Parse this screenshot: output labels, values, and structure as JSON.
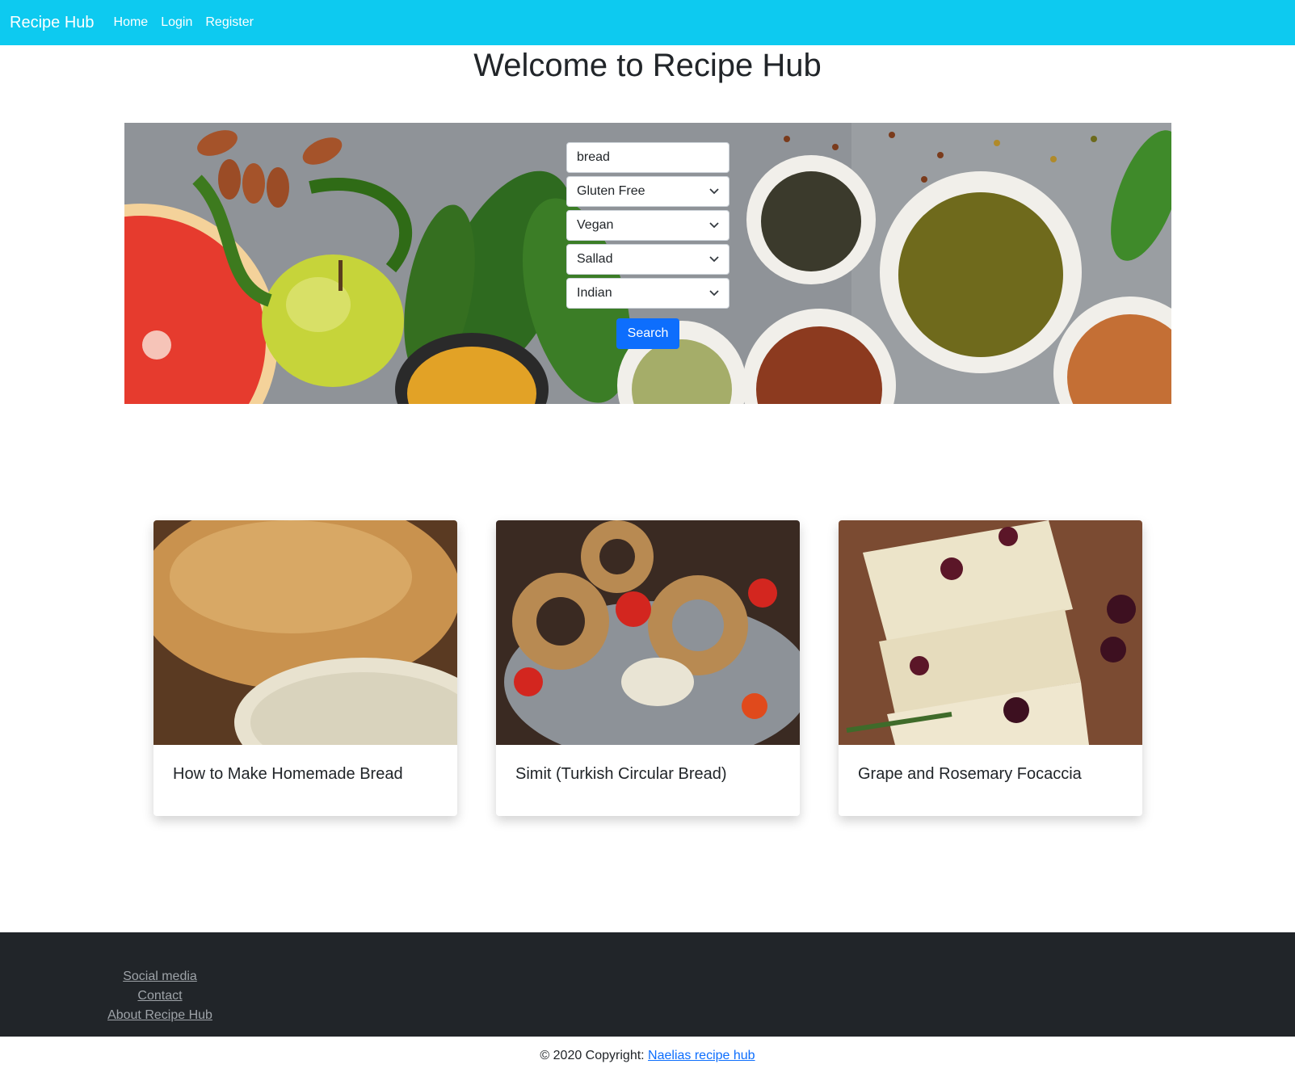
{
  "nav": {
    "brand": "Recipe Hub",
    "links": [
      "Home",
      "Login",
      "Register"
    ]
  },
  "page_title": "Welcome to Recipe Hub",
  "search": {
    "query": "bread",
    "filters": [
      "Gluten Free",
      "Vegan",
      "Sallad",
      "Indian"
    ],
    "button": "Search"
  },
  "cards": [
    {
      "title": "How to Make Homemade Bread"
    },
    {
      "title": "Simit (Turkish Circular Bread)"
    },
    {
      "title": "Grape and Rosemary Focaccia"
    }
  ],
  "footer": {
    "links": [
      "Social media",
      "Contact",
      "About Recipe Hub"
    ],
    "copyright_prefix": "© 2020 Copyright: ",
    "copyright_link": "Naelias recipe hub"
  },
  "colors": {
    "navbar": "#0dcaf0",
    "primary_button": "#0d6efd",
    "footer_bg": "#212529"
  }
}
